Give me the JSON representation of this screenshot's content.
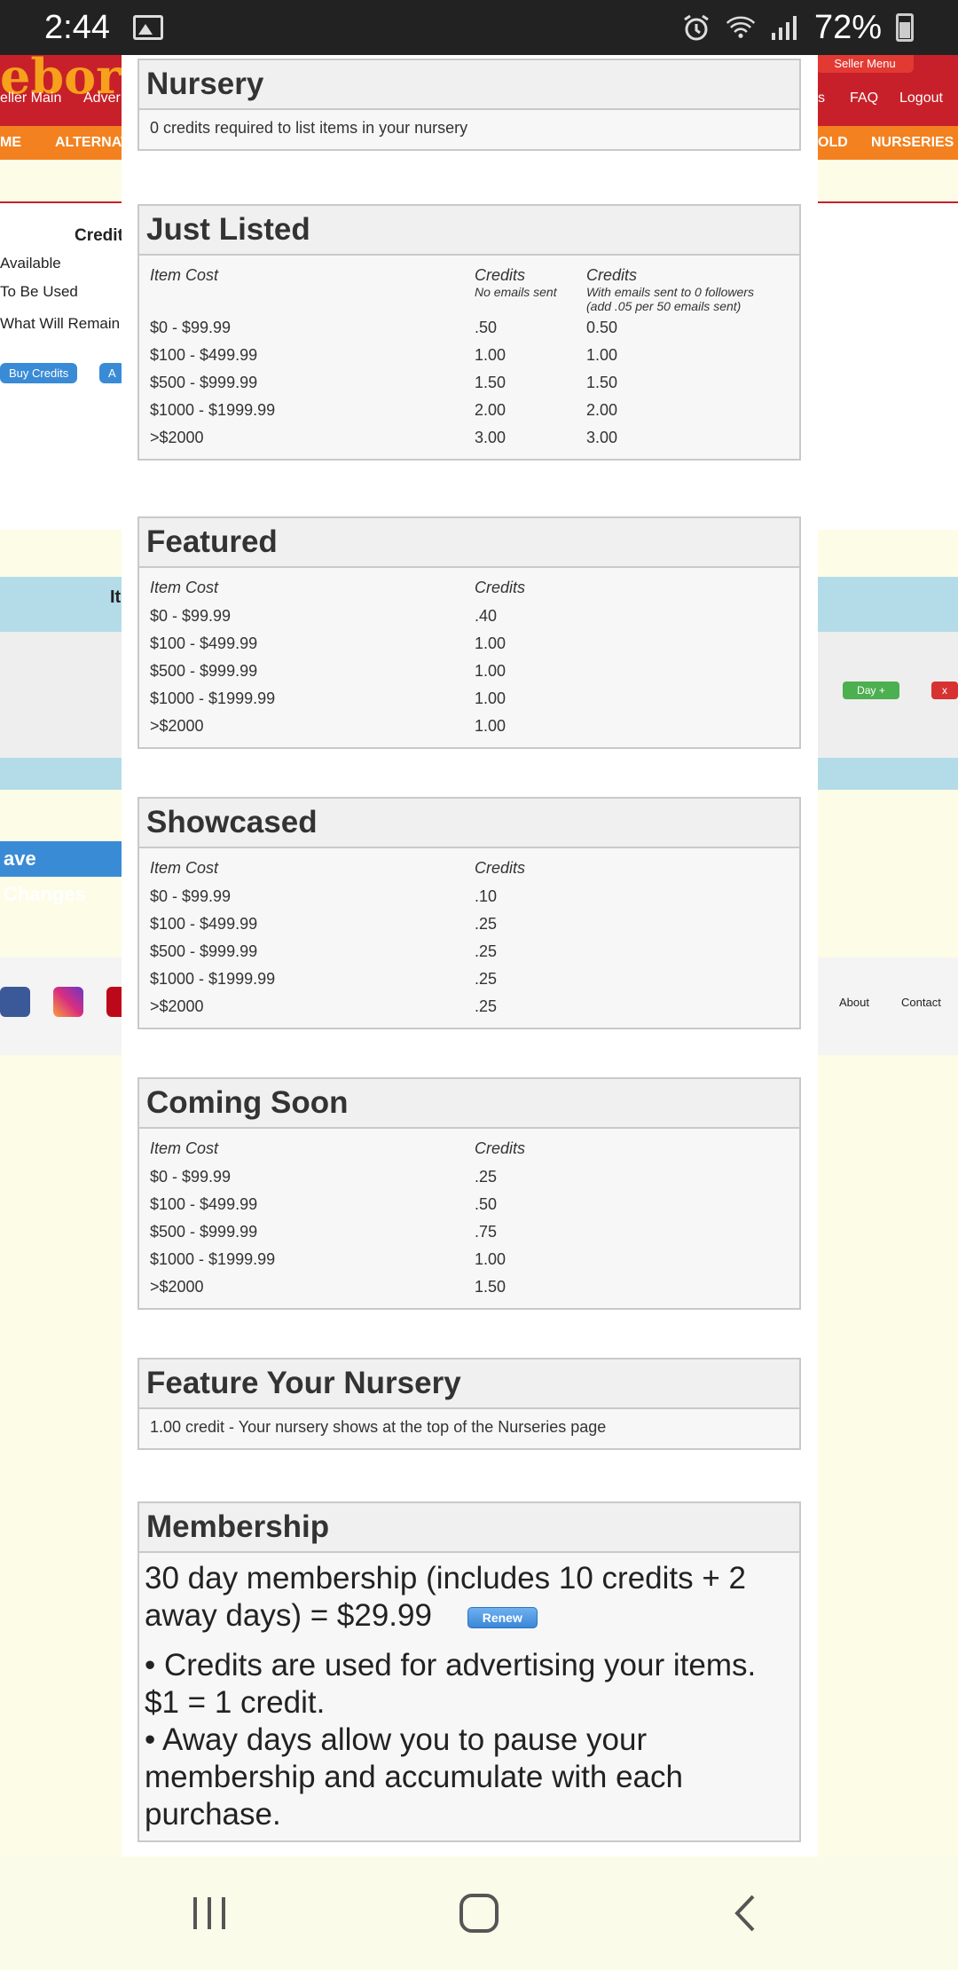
{
  "status_bar": {
    "time": "2:44",
    "battery": "72%"
  },
  "background": {
    "seller_menu": "Seller Menu",
    "nav_left": [
      "eller Main",
      "Adver"
    ],
    "nav_right": [
      "s",
      "FAQ",
      "Logout"
    ],
    "orange_nav": [
      "ME",
      "ALTERNAT",
      "OLD",
      "NURSERIES"
    ],
    "credits_heading": "Credit",
    "credits_rows": [
      "Available",
      "To Be Used",
      "What Will Remain"
    ],
    "buy_credits": "Buy Credits",
    "add_button": "A",
    "item_heading": "It",
    "day_plus": "Day +",
    "x_button": "x",
    "save_changes": "ave Changes",
    "footer_links": [
      "About",
      "Contact"
    ]
  },
  "modal": {
    "nursery": {
      "title": "Nursery",
      "text": "0 credits required to list items in your nursery"
    },
    "just_listed": {
      "title": "Just Listed",
      "col_item": "Item Cost",
      "col_credits": "Credits",
      "col_credits_sub": "No emails sent",
      "col_credits2": "Credits",
      "col_credits2_sub1": "With emails sent to 0 followers",
      "col_credits2_sub2": "(add .05 per 50 emails sent)",
      "rows": [
        {
          "cost": "$0 - $99.99",
          "credits": ".50",
          "credits2": "0.50"
        },
        {
          "cost": "$100 - $499.99",
          "credits": "1.00",
          "credits2": "1.00"
        },
        {
          "cost": "$500 - $999.99",
          "credits": "1.50",
          "credits2": "1.50"
        },
        {
          "cost": "$1000 - $1999.99",
          "credits": "2.00",
          "credits2": "2.00"
        },
        {
          "cost": ">$2000",
          "credits": "3.00",
          "credits2": "3.00"
        }
      ]
    },
    "featured": {
      "title": "Featured",
      "col_item": "Item Cost",
      "col_credits": "Credits",
      "rows": [
        {
          "cost": "$0 - $99.99",
          "credits": ".40"
        },
        {
          "cost": "$100 - $499.99",
          "credits": "1.00"
        },
        {
          "cost": "$500 - $999.99",
          "credits": "1.00"
        },
        {
          "cost": "$1000 - $1999.99",
          "credits": "1.00"
        },
        {
          "cost": ">$2000",
          "credits": "1.00"
        }
      ]
    },
    "showcased": {
      "title": "Showcased",
      "col_item": "Item Cost",
      "col_credits": "Credits",
      "rows": [
        {
          "cost": "$0 - $99.99",
          "credits": ".10"
        },
        {
          "cost": "$100 - $499.99",
          "credits": ".25"
        },
        {
          "cost": "$500 - $999.99",
          "credits": ".25"
        },
        {
          "cost": "$1000 - $1999.99",
          "credits": ".25"
        },
        {
          "cost": ">$2000",
          "credits": ".25"
        }
      ]
    },
    "coming_soon": {
      "title": "Coming Soon",
      "col_item": "Item Cost",
      "col_credits": "Credits",
      "rows": [
        {
          "cost": "$0 - $99.99",
          "credits": ".25"
        },
        {
          "cost": "$100 - $499.99",
          "credits": ".50"
        },
        {
          "cost": "$500 - $999.99",
          "credits": ".75"
        },
        {
          "cost": "$1000 - $1999.99",
          "credits": "1.00"
        },
        {
          "cost": ">$2000",
          "credits": "1.50"
        }
      ]
    },
    "feature_nursery": {
      "title": "Feature Your Nursery",
      "text": "1.00 credit - Your nursery shows at the top of the Nurseries page"
    },
    "membership": {
      "title": "Membership",
      "offer": "30 day membership (includes 10 credits + 2 away days) = $29.99",
      "renew": "Renew",
      "bullet1": "• Credits are used for advertising your items. $1 = 1 credit.",
      "bullet2": "• Away days allow you to pause your membership and accumulate with each purchase."
    }
  }
}
